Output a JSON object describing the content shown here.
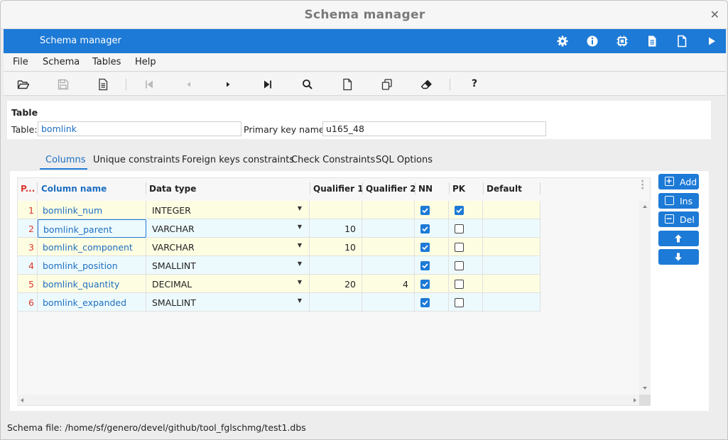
{
  "window": {
    "title": "Schema manager",
    "close_glyph": "✕"
  },
  "appbar": {
    "title": "Schema manager",
    "icons": [
      "gear-icon",
      "info-icon",
      "chip-icon",
      "document-text-icon",
      "document-icon",
      "play-icon"
    ]
  },
  "menu": {
    "file": "File",
    "schema": "Schema",
    "tables": "Tables",
    "help": "Help"
  },
  "toolbar": {
    "icons": [
      "open-folder-icon",
      "save-icon",
      "document-text-icon",
      "first-record-icon",
      "previous-record-icon",
      "next-record-icon",
      "last-record-icon",
      "search-icon",
      "new-document-icon",
      "copy-icon",
      "eraser-icon",
      "help-icon"
    ]
  },
  "table_section": {
    "header": "Table",
    "table_label": "Table:",
    "table_value": "bomlink",
    "pk_label": "Primary key name:",
    "pk_value": "u165_48"
  },
  "tabs": [
    "Columns",
    "Unique constraints",
    "Foreign keys constraints",
    "Check Constraints",
    "SQL Options"
  ],
  "active_tab": "Columns",
  "grid": {
    "headers": {
      "pos": "P...",
      "name": "Column name",
      "type": "Data type",
      "q1": "Qualifier 1",
      "q2": "Qualifier 2",
      "nn": "NN",
      "pk": "PK",
      "def": "Default"
    },
    "rows": [
      {
        "pos": "1",
        "name": "bomlink_num",
        "type": "INTEGER",
        "q1": "",
        "q2": "",
        "nn": true,
        "pk": true,
        "def": ""
      },
      {
        "pos": "2",
        "name": "bomlink_parent",
        "type": "VARCHAR",
        "q1": "10",
        "q2": "",
        "nn": true,
        "pk": false,
        "def": ""
      },
      {
        "pos": "3",
        "name": "bomlink_component",
        "type": "VARCHAR",
        "q1": "10",
        "q2": "",
        "nn": true,
        "pk": false,
        "def": ""
      },
      {
        "pos": "4",
        "name": "bomlink_position",
        "type": "SMALLINT",
        "q1": "",
        "q2": "",
        "nn": true,
        "pk": false,
        "def": ""
      },
      {
        "pos": "5",
        "name": "bomlink_quantity",
        "type": "DECIMAL",
        "q1": "20",
        "q2": "4",
        "nn": true,
        "pk": false,
        "def": ""
      },
      {
        "pos": "6",
        "name": "bomlink_expanded",
        "type": "SMALLINT",
        "q1": "",
        "q2": "",
        "nn": true,
        "pk": false,
        "def": ""
      }
    ]
  },
  "side_buttons": {
    "add": "Add",
    "ins": "Ins",
    "del": "Del"
  },
  "status": {
    "text": "Schema file: /home/sf/genero/devel/github/tool_fglschmg/test1.dbs"
  },
  "colors": {
    "accent": "#1d7ad6",
    "row_yellow": "#fdfde2",
    "row_cyan": "#edfafd",
    "link_blue": "#1d6ec0",
    "pos_red": "#d9382e"
  }
}
